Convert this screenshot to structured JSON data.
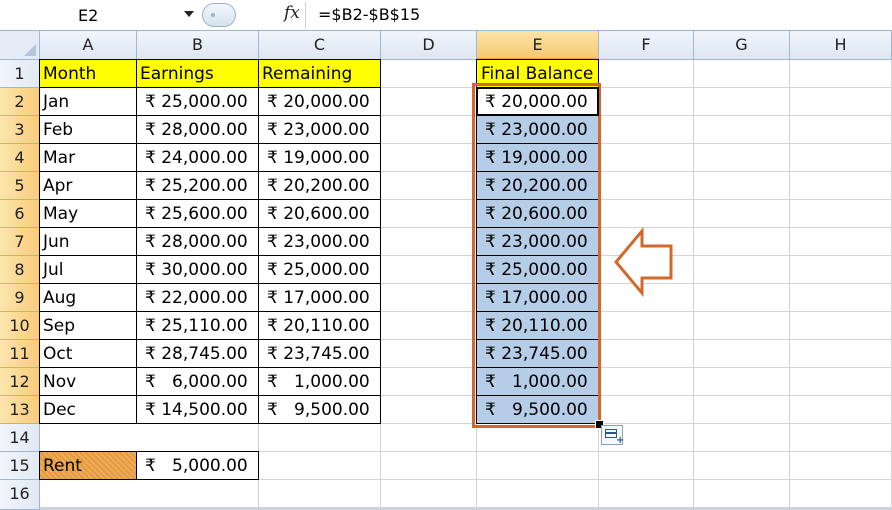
{
  "namebox": {
    "value": "E2"
  },
  "formula_bar": {
    "fx_label": "fx",
    "formula": "=$B2-$B$15"
  },
  "columns": [
    "A",
    "B",
    "C",
    "D",
    "E",
    "F",
    "G",
    "H"
  ],
  "selected_column": "E",
  "rows": [
    "1",
    "2",
    "3",
    "4",
    "5",
    "6",
    "7",
    "8",
    "9",
    "10",
    "11",
    "12",
    "13",
    "14",
    "15",
    "16"
  ],
  "selected_rows": [
    "2",
    "3",
    "4",
    "5",
    "6",
    "7",
    "8",
    "9",
    "10",
    "11",
    "12",
    "13"
  ],
  "headers": {
    "month": "Month",
    "earnings": "Earnings",
    "remaining": "Remaining",
    "final_balance": "Final Balance"
  },
  "data": [
    {
      "month": "Jan",
      "earnings": "₹ 25,000.00",
      "remaining": "₹ 20,000.00",
      "final": "₹ 20,000.00"
    },
    {
      "month": "Feb",
      "earnings": "₹ 28,000.00",
      "remaining": "₹ 23,000.00",
      "final": "₹ 23,000.00"
    },
    {
      "month": "Mar",
      "earnings": "₹ 24,000.00",
      "remaining": "₹ 19,000.00",
      "final": "₹ 19,000.00"
    },
    {
      "month": "Apr",
      "earnings": "₹ 25,200.00",
      "remaining": "₹ 20,200.00",
      "final": "₹ 20,200.00"
    },
    {
      "month": "May",
      "earnings": "₹ 25,600.00",
      "remaining": "₹ 20,600.00",
      "final": "₹ 20,600.00"
    },
    {
      "month": "Jun",
      "earnings": "₹ 28,000.00",
      "remaining": "₹ 23,000.00",
      "final": "₹ 23,000.00"
    },
    {
      "month": "Jul",
      "earnings": "₹ 30,000.00",
      "remaining": "₹ 25,000.00",
      "final": "₹ 25,000.00"
    },
    {
      "month": "Aug",
      "earnings": "₹ 22,000.00",
      "remaining": "₹ 17,000.00",
      "final": "₹ 17,000.00"
    },
    {
      "month": "Sep",
      "earnings": "₹ 25,110.00",
      "remaining": "₹ 20,110.00",
      "final": "₹ 20,110.00"
    },
    {
      "month": "Oct",
      "earnings": "₹ 28,745.00",
      "remaining": "₹ 23,745.00",
      "final": "₹ 23,745.00"
    },
    {
      "month": "Nov",
      "earnings": "₹   6,000.00",
      "remaining": "₹   1,000.00",
      "final": "₹   1,000.00"
    },
    {
      "month": "Dec",
      "earnings": "₹ 14,500.00",
      "remaining": "₹   9,500.00",
      "final": "₹   9,500.00"
    }
  ],
  "rent": {
    "label": "Rent",
    "value": "₹   5,000.00"
  },
  "colors": {
    "header_fill": "#ffff00",
    "rent_fill": "#e79a3a",
    "selection_fill": "#b6cde8",
    "annotation": "#d2692b"
  },
  "icons": {
    "autofill_options": "autofill-options-icon",
    "callout_arrow": "left-arrow-icon"
  }
}
